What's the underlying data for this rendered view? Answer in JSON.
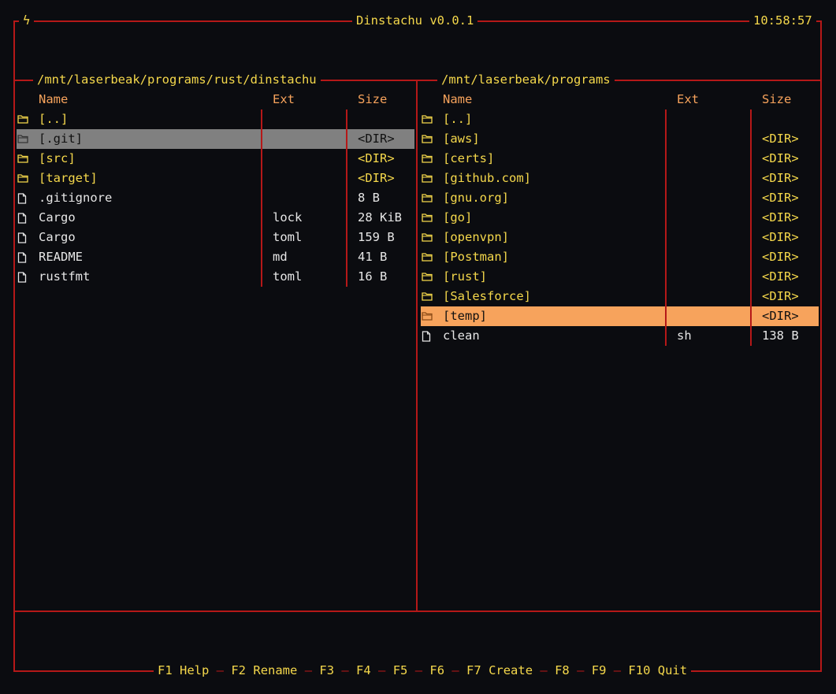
{
  "app": {
    "title": "Dinstachu v0.0.1",
    "clock": "10:58:57",
    "bolt_icon": "lightning-bolt-icon",
    "colors": {
      "border": "#b51818",
      "header": "#f7a35c",
      "dir": "#f5d84b",
      "file": "#e6e6e6",
      "selected_inactive": "#808080",
      "selected_active": "#f7a35c",
      "background": "#0b0c10"
    }
  },
  "left_panel": {
    "path": "/mnt/laserbeak/programs/rust/dinstachu",
    "columns": {
      "name": "Name",
      "ext": "Ext",
      "size": "Size"
    },
    "rows": [
      {
        "name": "[..]",
        "ext": "",
        "size": "",
        "type": "dir"
      },
      {
        "name": "[.git]",
        "ext": "",
        "size": "<DIR>",
        "type": "dir",
        "selected": "inactive"
      },
      {
        "name": "[src]",
        "ext": "",
        "size": "<DIR>",
        "type": "dir"
      },
      {
        "name": "[target]",
        "ext": "",
        "size": "<DIR>",
        "type": "dir"
      },
      {
        "name": ".gitignore",
        "ext": "",
        "size": "8 B",
        "type": "file"
      },
      {
        "name": "Cargo",
        "ext": "lock",
        "size": "28 KiB",
        "type": "file"
      },
      {
        "name": "Cargo",
        "ext": "toml",
        "size": "159 B",
        "type": "file"
      },
      {
        "name": "README",
        "ext": "md",
        "size": "41 B",
        "type": "file"
      },
      {
        "name": "rustfmt",
        "ext": "toml",
        "size": "16 B",
        "type": "file"
      }
    ]
  },
  "right_panel": {
    "path": "/mnt/laserbeak/programs",
    "columns": {
      "name": "Name",
      "ext": "Ext",
      "size": "Size"
    },
    "rows": [
      {
        "name": "[..]",
        "ext": "",
        "size": "",
        "type": "dir"
      },
      {
        "name": "[aws]",
        "ext": "",
        "size": "<DIR>",
        "type": "dir"
      },
      {
        "name": "[certs]",
        "ext": "",
        "size": "<DIR>",
        "type": "dir"
      },
      {
        "name": "[github.com]",
        "ext": "",
        "size": "<DIR>",
        "type": "dir"
      },
      {
        "name": "[gnu.org]",
        "ext": "",
        "size": "<DIR>",
        "type": "dir"
      },
      {
        "name": "[go]",
        "ext": "",
        "size": "<DIR>",
        "type": "dir"
      },
      {
        "name": "[openvpn]",
        "ext": "",
        "size": "<DIR>",
        "type": "dir"
      },
      {
        "name": "[Postman]",
        "ext": "",
        "size": "<DIR>",
        "type": "dir"
      },
      {
        "name": "[rust]",
        "ext": "",
        "size": "<DIR>",
        "type": "dir"
      },
      {
        "name": "[Salesforce]",
        "ext": "",
        "size": "<DIR>",
        "type": "dir"
      },
      {
        "name": "[temp]",
        "ext": "",
        "size": "<DIR>",
        "type": "dir",
        "selected": "active"
      },
      {
        "name": "clean",
        "ext": "sh",
        "size": "138 B",
        "type": "file"
      }
    ]
  },
  "footer": {
    "keys": [
      {
        "key": "F1",
        "label": "Help"
      },
      {
        "key": "F2",
        "label": "Rename"
      },
      {
        "key": "F3",
        "label": ""
      },
      {
        "key": "F4",
        "label": ""
      },
      {
        "key": "F5",
        "label": ""
      },
      {
        "key": "F6",
        "label": ""
      },
      {
        "key": "F7",
        "label": "Create"
      },
      {
        "key": "F8",
        "label": ""
      },
      {
        "key": "F9",
        "label": ""
      },
      {
        "key": "F10",
        "label": "Quit"
      }
    ]
  }
}
